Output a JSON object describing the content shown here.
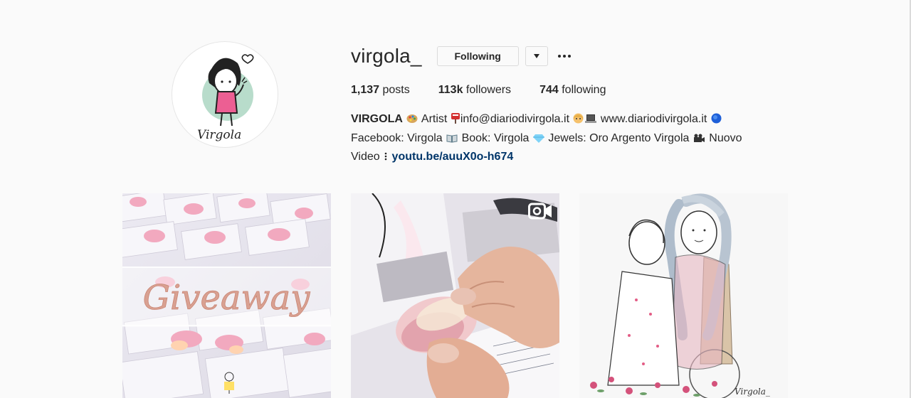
{
  "profile": {
    "username": "virgola_",
    "avatar_caption": "Virgola",
    "following_label": "Following",
    "stats": {
      "posts_count": "1,137",
      "posts_label": "posts",
      "followers_count": "113k",
      "followers_label": "followers",
      "following_count": "744",
      "following_label": "following"
    },
    "bio": {
      "name": "VIRGOLA",
      "seg1": "Artist",
      "seg2": "info@diariodivirgola.it",
      "seg3": "www.diariodivirgola.it",
      "seg4": "Facebook: Virgola",
      "seg5": "Book: Virgola",
      "seg6": "Jewels: Oro Argento Virgola",
      "seg7": "Nuovo",
      "seg8": "Video",
      "link": "youtu.be/auuX0o-h674"
    }
  },
  "posts": [
    {
      "overlay_text": "Giveaway",
      "icon": "none"
    },
    {
      "icon": "video-icon"
    },
    {
      "signature": "Virgola_",
      "icon": "none"
    }
  ],
  "colors": {
    "background": "#fafafa",
    "text": "#262626",
    "link": "#003569",
    "border": "#dbdbdb"
  }
}
